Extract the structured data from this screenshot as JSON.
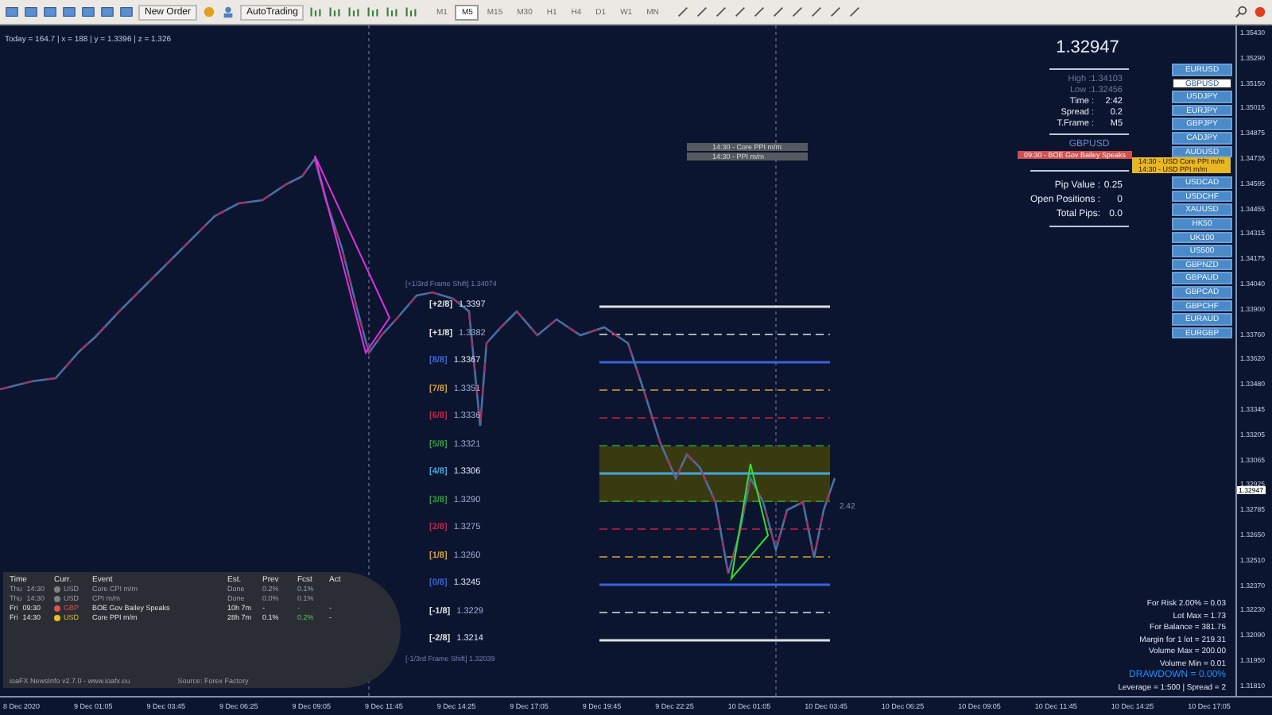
{
  "toolbar": {
    "new_order": "New Order",
    "auto_trading": "AutoTrading",
    "timeframes": [
      {
        "label": "M1",
        "selected": false
      },
      {
        "label": "M5",
        "selected": true
      },
      {
        "label": "M15",
        "selected": false
      },
      {
        "label": "M30",
        "selected": false
      },
      {
        "label": "H1",
        "selected": false
      },
      {
        "label": "H4",
        "selected": false
      },
      {
        "label": "D1",
        "selected": false
      },
      {
        "label": "W1",
        "selected": false
      },
      {
        "label": "MN",
        "selected": false
      }
    ]
  },
  "chart": {
    "info_line": "Today = 164.7  |  x = 188  |  y = 1.3396  |  z = 1.326",
    "event_labels": [
      "14:30 - Core PPI m/m",
      "14:30 - PPI m/m"
    ],
    "frame_shift_top": "[+1/3rd Frame Shift]  1.34074",
    "frame_shift_bottom": "[-1/3rd Frame Shift]  1.32039",
    "levels": [
      {
        "label": "[+2/8]",
        "price": "1.3397",
        "color": "#e0e0e0"
      },
      {
        "label": "[+1/8]",
        "price": "1.3382",
        "color": "#e0e0e0"
      },
      {
        "label": "[8/8]",
        "price": "1.3367",
        "color": "#3b63d8"
      },
      {
        "label": "[7/8]",
        "price": "1.3351",
        "color": "#e0a030"
      },
      {
        "label": "[6/8]",
        "price": "1.3336",
        "color": "#d02040"
      },
      {
        "label": "[5/8]",
        "price": "1.3321",
        "color": "#30a030"
      },
      {
        "label": "[4/8]",
        "price": "1.3306",
        "color": "#40a8e0"
      },
      {
        "label": "[3/8]",
        "price": "1.3290",
        "color": "#30a030"
      },
      {
        "label": "[2/8]",
        "price": "1.3275",
        "color": "#d02040"
      },
      {
        "label": "[1/8]",
        "price": "1.3260",
        "color": "#e0a030"
      },
      {
        "label": "[0/8]",
        "price": "1.3245",
        "color": "#3b63d8"
      },
      {
        "label": "[-1/8]",
        "price": "1.3229",
        "color": "#e0e0e0"
      },
      {
        "label": "[-2/8]",
        "price": "1.3214",
        "color": "#e0e0e0"
      }
    ],
    "price_note": "2.42"
  },
  "info_panel": {
    "price": "1.32947",
    "stats": [
      {
        "label": "High :",
        "value": "1.34103",
        "dim": true
      },
      {
        "label": "Low :",
        "value": "1.32456",
        "dim": true
      },
      {
        "label": "Time :",
        "value": "2:42",
        "dim": false
      },
      {
        "label": "Spread :",
        "value": "0.2",
        "dim": false
      },
      {
        "label": "T.Frame :",
        "value": "M5",
        "dim": false
      }
    ],
    "symbol": "GBPUSD",
    "positions": [
      {
        "label": "Pip Value :",
        "value": "0.25"
      },
      {
        "label": "Open Positions :",
        "value": "0"
      },
      {
        "label": "Total Pips:",
        "value": "0.0"
      }
    ]
  },
  "news_banners": [
    {
      "text": "09:30 - BOE Gov Bailey Speaks",
      "color": "#d05050"
    },
    {
      "text": "14:30 - USD Core PPI m/m",
      "color": "#e8b820"
    },
    {
      "text": "14:30 - USD PPI m/m",
      "color": "#e8b820"
    }
  ],
  "symbols": [
    {
      "label": "EURUSD",
      "selected": false
    },
    {
      "label": "GBPUSD",
      "selected": true
    },
    {
      "label": "USDJPY",
      "selected": false
    },
    {
      "label": "EURJPY",
      "selected": false
    },
    {
      "label": "GBPJPY",
      "selected": false
    },
    {
      "label": "CADJPY",
      "selected": false
    },
    {
      "label": "AUDUSD",
      "selected": false
    },
    {
      "label": "USDCAD",
      "selected": false
    },
    {
      "label": "USDCHF",
      "selected": false
    },
    {
      "label": "XAUUSD",
      "selected": false
    },
    {
      "label": "HK50",
      "selected": false
    },
    {
      "label": "UK100",
      "selected": false
    },
    {
      "label": "US500",
      "selected": false
    },
    {
      "label": "GBPNZD",
      "selected": false
    },
    {
      "label": "GBPAUD",
      "selected": false
    },
    {
      "label": "GBPCAD",
      "selected": false
    },
    {
      "label": "GBPCHF",
      "selected": false
    },
    {
      "label": "EURAUD",
      "selected": false
    },
    {
      "label": "EURGBP",
      "selected": false
    }
  ],
  "news": {
    "columns": [
      "Time",
      "Curr.",
      "Event",
      "Est.",
      "Prev",
      "Fcst",
      "Act"
    ],
    "rows": [
      {
        "day": "Thu",
        "time": "14:30",
        "currency": "USD",
        "color": "#808080",
        "event": "Core CPI m/m",
        "est": "Done",
        "prev": "0.2%",
        "fcst": "0.1%",
        "act": "",
        "past": true
      },
      {
        "day": "Thu",
        "time": "14:30",
        "currency": "USD",
        "color": "#808080",
        "event": "CPI m/m",
        "est": "Done",
        "prev": "0.0%",
        "fcst": "0.1%",
        "act": "",
        "past": true
      },
      {
        "day": "Fri",
        "time": "09:30",
        "currency": "GBP",
        "color": "#e05050",
        "event": "BOE Gov Bailey Speaks",
        "est": "10h 7m",
        "prev": "-",
        "fcst": "-",
        "act": "-",
        "past": false
      },
      {
        "day": "Fri",
        "time": "14:30",
        "currency": "USD",
        "color": "#e8c020",
        "event": "Core PPI m/m",
        "est": "28h 7m",
        "prev": "0.1%",
        "fcst": "0.2%",
        "act": "-",
        "past": false
      }
    ],
    "footer": "ioaFX NewsInfo v2.7.0  -  www.ioafx.eu",
    "source": "Source: Forex Factory"
  },
  "risk": [
    {
      "text": "For Risk 2.00% = 0.03",
      "kind": "plain"
    },
    {
      "text": "Lot Max = 1.73",
      "kind": "plain"
    },
    {
      "text": "For Balance = 381.75",
      "kind": "plain"
    },
    {
      "text": "Margin for 1 lot = 219.31",
      "kind": "plain"
    },
    {
      "text": "Volume Max = 200.00",
      "kind": "plain"
    },
    {
      "text": "Volume Min = 0.01",
      "kind": "plain"
    },
    {
      "text": "DRAWDOWN = 0.00%",
      "kind": "highlight"
    },
    {
      "text": "Leverage = 1:500 | Spread = 2",
      "kind": "plain"
    }
  ],
  "price_axis": [
    "1.35430",
    "1.35290",
    "1.35150",
    "1.35015",
    "1.34875",
    "1.34735",
    "1.34595",
    "1.34455",
    "1.34315",
    "1.34175",
    "1.34040",
    "1.33900",
    "1.33760",
    "1.33620",
    "1.33480",
    "1.33345",
    "1.33205",
    "1.33065",
    "1.32925",
    "1.32785",
    "1.32650",
    "1.32510",
    "1.32370",
    "1.32230",
    "1.32090",
    "1.31950",
    "1.31810"
  ],
  "current_price_tag": "1.32947",
  "time_axis": [
    "8 Dec 2020",
    "9 Dec 01:05",
    "9 Dec 03:45",
    "9 Dec 06:25",
    "9 Dec 09:05",
    "9 Dec 11:45",
    "9 Dec 14:25",
    "9 Dec 17:05",
    "9 Dec 19:45",
    "9 Dec 22:25",
    "10 Dec 01:05",
    "10 Dec 03:45",
    "10 Dec 06:25",
    "10 Dec 09:05",
    "10 Dec 11:45",
    "10 Dec 14:25",
    "10 Dec 17:05"
  ]
}
